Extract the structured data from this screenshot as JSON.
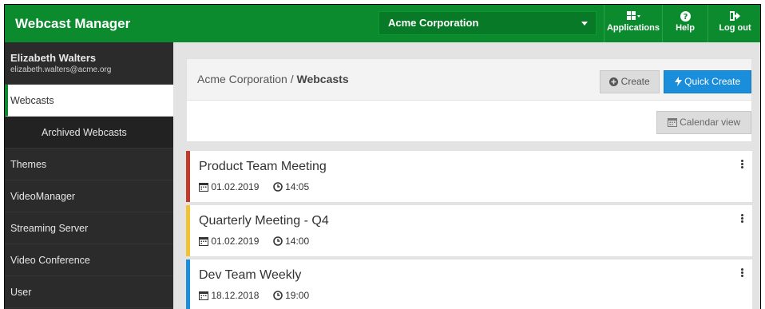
{
  "header": {
    "brand": "Webcast Manager",
    "tenant": "Acme Corporation",
    "applications_label": "Applications",
    "help_label": "Help",
    "logout_label": "Log out"
  },
  "user": {
    "name": "Elizabeth Walters",
    "email": "elizabeth.walters@acme.org"
  },
  "sidebar": {
    "items": [
      {
        "label": "Webcasts"
      },
      {
        "label": "Archived Webcasts"
      },
      {
        "label": "Themes"
      },
      {
        "label": "VideoManager"
      },
      {
        "label": "Streaming Server"
      },
      {
        "label": "Video Conference"
      },
      {
        "label": "User"
      }
    ]
  },
  "main": {
    "breadcrumb_parent": "Acme Corporation",
    "breadcrumb_separator": " / ",
    "breadcrumb_current": "Webcasts",
    "create_label": "Create",
    "quick_create_label": "Quick Create",
    "calendar_label": "Calendar view",
    "webcasts": [
      {
        "title": "Product Team Meeting",
        "date": "01.02.2019",
        "time": "14:05",
        "color": "#c0392b"
      },
      {
        "title": "Quarterly Meeting - Q4",
        "date": "01.02.2019",
        "time": "14:00",
        "color": "#f1c232"
      },
      {
        "title": "Dev Team Weekly",
        "date": "18.12.2018",
        "time": "19:00",
        "color": "#1a8ddb"
      }
    ]
  },
  "colors": {
    "brand_green": "#0b8a2e",
    "primary_blue": "#1a8ddb",
    "sidebar_dark": "#2b2b2b"
  }
}
